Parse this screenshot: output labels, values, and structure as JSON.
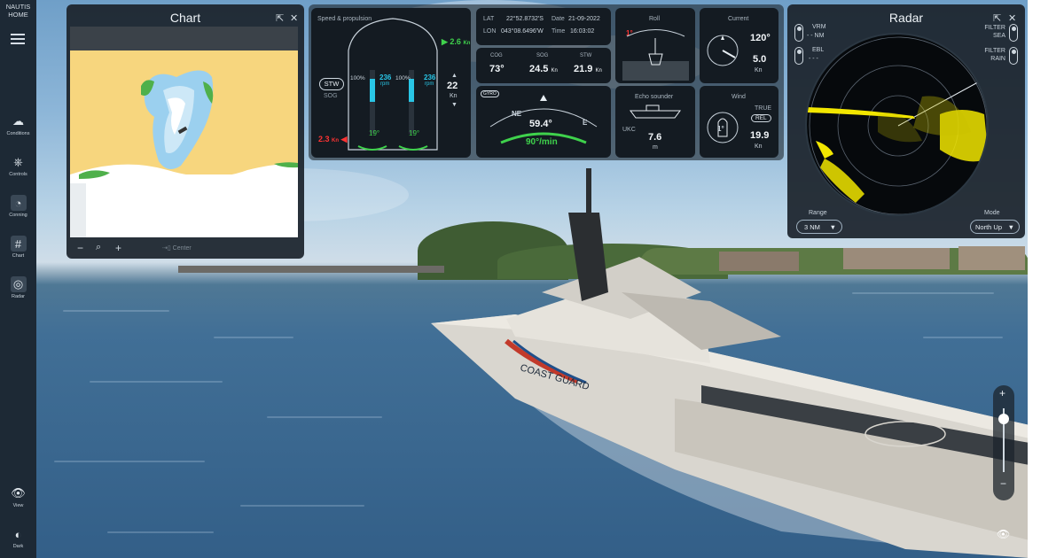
{
  "app": {
    "logo_line1": "NAUTIS",
    "logo_line2": "HOME"
  },
  "sidebar": {
    "items": [
      {
        "label": "Conditions",
        "icon": "cloud-icon"
      },
      {
        "label": "Controls",
        "icon": "helm-icon"
      },
      {
        "label": "Conning",
        "icon": "gauge-icon"
      },
      {
        "label": "Chart",
        "icon": "grid-icon"
      },
      {
        "label": "Radar",
        "icon": "radar-icon"
      }
    ],
    "bottom": [
      {
        "label": "View",
        "icon": "eye-icon"
      },
      {
        "label": "Dark",
        "icon": "contrast-icon"
      }
    ]
  },
  "chart_panel": {
    "title": "Chart",
    "zoom_out": "−",
    "zoom_in": "+",
    "center_label": "Center"
  },
  "conning": {
    "propulsion": {
      "title": "Speed & propulsion",
      "speed": "2.6",
      "speed_unit": "Kn",
      "mode_button": "STW",
      "mode_alt": "SOG",
      "left_pct": "100%",
      "left_rpm": "236",
      "right_pct": "100%",
      "right_rpm": "236",
      "rpm_unit": "rpm",
      "heading_speed": "22",
      "heading_unit": "Kn",
      "bottom_speed": "2.3",
      "bottom_unit": "Kn",
      "left_rudder": "19°",
      "right_rudder": "19°"
    },
    "position": {
      "lat_label": "LAT",
      "lat": "22°52.8732'S",
      "lon_label": "LON",
      "lon": "043°08.6496'W",
      "date_label": "Date",
      "date": "21-09-2022",
      "time_label": "Time",
      "time": "16:03:02"
    },
    "motion": {
      "cog_label": "COG",
      "cog": "73°",
      "sog_label": "SOG",
      "sog": "24.5",
      "sog_unit": "Kn",
      "stw_label": "STW",
      "stw": "21.9",
      "stw_unit": "Kn"
    },
    "heading": {
      "badge": "GYRO",
      "value": "59.4°",
      "rot": "90°/min",
      "ne": "NE",
      "e": "E"
    },
    "roll": {
      "title": "Roll",
      "value": "1°"
    },
    "echo": {
      "title": "Echo sounder",
      "ukc_label": "UKC",
      "value": "7.6",
      "unit": "m"
    },
    "current": {
      "title": "Current",
      "direction": "120°",
      "speed": "5.0",
      "unit": "Kn"
    },
    "wind": {
      "title": "Wind",
      "true_label": "TRUE",
      "rel_label": "REL",
      "direction": "1°",
      "speed": "19.9",
      "unit": "Kn"
    }
  },
  "radar_panel": {
    "title": "Radar",
    "vrm_label": "VRM",
    "vrm_value": "- - NM",
    "ebl_label": "EBL",
    "ebl_value": "- - -",
    "filter_sea": "FILTER SEA",
    "filter_rain": "FILTER RAIN",
    "range_label": "Range",
    "range_value": "3 NM",
    "mode_label": "Mode",
    "mode_value": "North Up"
  },
  "scene": {
    "ship_text": "COAST GUARD"
  },
  "colors": {
    "panel_bg": "#1c242c",
    "tile_bg": "#141b22",
    "accent_green": "#3fd24c",
    "accent_red": "#ff3333",
    "accent_cyan": "#29c6e6",
    "radar_echo": "#f2e600"
  }
}
